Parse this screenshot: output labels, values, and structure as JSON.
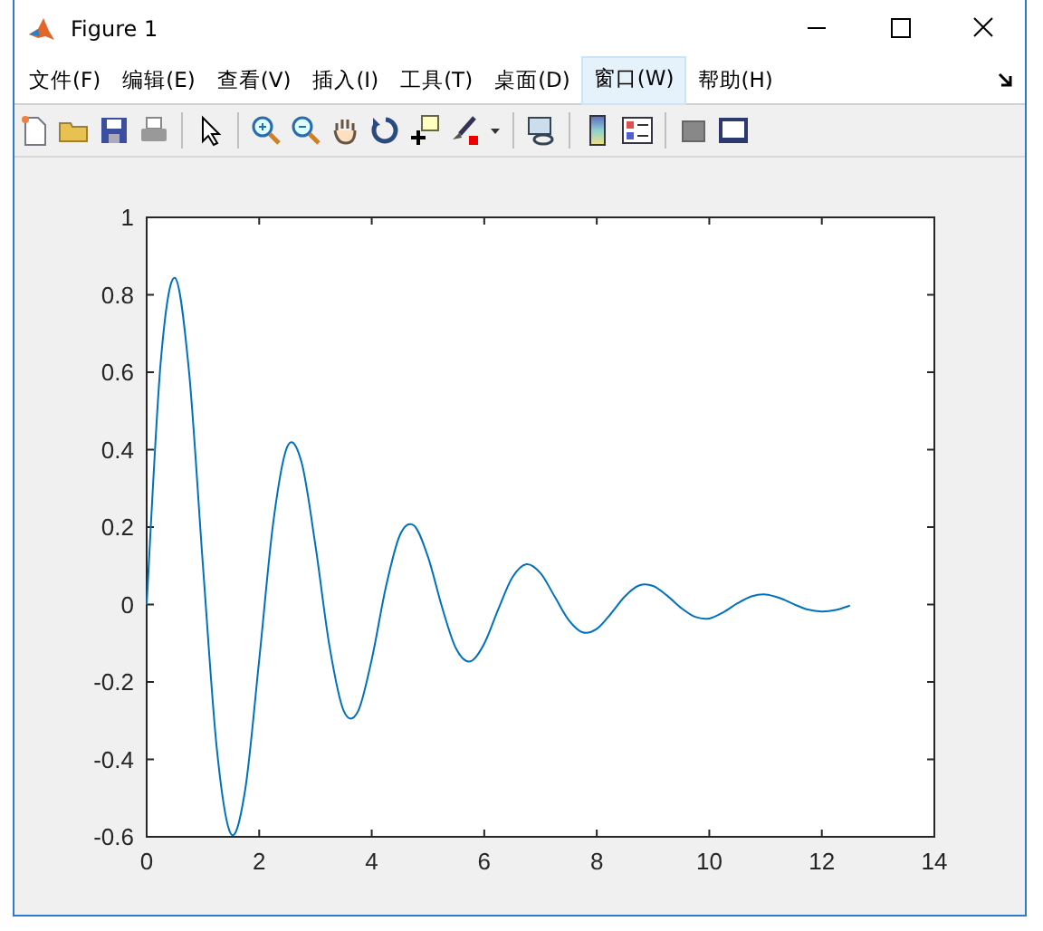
{
  "window": {
    "title": "Figure 1"
  },
  "menu": [
    {
      "label": "文件(F)",
      "selected": false
    },
    {
      "label": "编辑(E)",
      "selected": false
    },
    {
      "label": "查看(V)",
      "selected": false
    },
    {
      "label": "插入(I)",
      "selected": false
    },
    {
      "label": "工具(T)",
      "selected": false
    },
    {
      "label": "桌面(D)",
      "selected": false
    },
    {
      "label": "窗口(W)",
      "selected": true
    },
    {
      "label": "帮助(H)",
      "selected": false
    }
  ],
  "chart_data": {
    "type": "line",
    "x": [
      0,
      0.25,
      0.5,
      0.75,
      1,
      1.25,
      1.5,
      1.75,
      2,
      2.25,
      2.5,
      2.75,
      3,
      3.25,
      3.5,
      3.75,
      4,
      4.25,
      4.5,
      4.75,
      5,
      5.25,
      5.5,
      5.75,
      6,
      6.25,
      6.5,
      6.75,
      7,
      7.25,
      7.5,
      7.75,
      8,
      8.25,
      8.5,
      8.75,
      9,
      9.25,
      9.5,
      9.75,
      10,
      10.25,
      10.5,
      10.75,
      11,
      11.25,
      11.5,
      11.75,
      12,
      12.25,
      12.5
    ],
    "series": [
      {
        "color": "#0072bd",
        "values": [
          0,
          0.627,
          0.844,
          0.606,
          0.101,
          -0.377,
          -0.593,
          -0.479,
          -0.143,
          0.212,
          0.408,
          0.369,
          0.152,
          -0.108,
          -0.274,
          -0.278,
          -0.142,
          0.044,
          0.179,
          0.204,
          0.123,
          -0.007,
          -0.114,
          -0.147,
          -0.101,
          -0.012,
          0.07,
          0.104,
          0.081,
          0.021,
          -0.04,
          -0.072,
          -0.063,
          -0.024,
          0.021,
          0.049,
          0.048,
          0.023,
          -0.009,
          -0.032,
          -0.036,
          -0.02,
          0.003,
          0.021,
          0.026,
          0.017,
          0.001,
          -0.013,
          -0.018,
          -0.014,
          -0.003
        ]
      }
    ],
    "xlim": [
      0,
      14
    ],
    "ylim": [
      -0.6,
      1
    ],
    "xticks": [
      {
        "value": 0,
        "label": "0"
      },
      {
        "value": 2,
        "label": "2"
      },
      {
        "value": 4,
        "label": "4"
      },
      {
        "value": 6,
        "label": "6"
      },
      {
        "value": 8,
        "label": "8"
      },
      {
        "value": 10,
        "label": "10"
      },
      {
        "value": 12,
        "label": "12"
      },
      {
        "value": 14,
        "label": "14"
      }
    ],
    "yticks": [
      {
        "value": -0.6,
        "label": "-0.6"
      },
      {
        "value": -0.4,
        "label": "-0.4"
      },
      {
        "value": -0.2,
        "label": "-0.2"
      },
      {
        "value": 0,
        "label": "0"
      },
      {
        "value": 0.2,
        "label": "0.2"
      },
      {
        "value": 0.4,
        "label": "0.4"
      },
      {
        "value": 0.6,
        "label": "0.6"
      },
      {
        "value": 0.8,
        "label": "0.8"
      },
      {
        "value": 1,
        "label": "1"
      }
    ]
  }
}
